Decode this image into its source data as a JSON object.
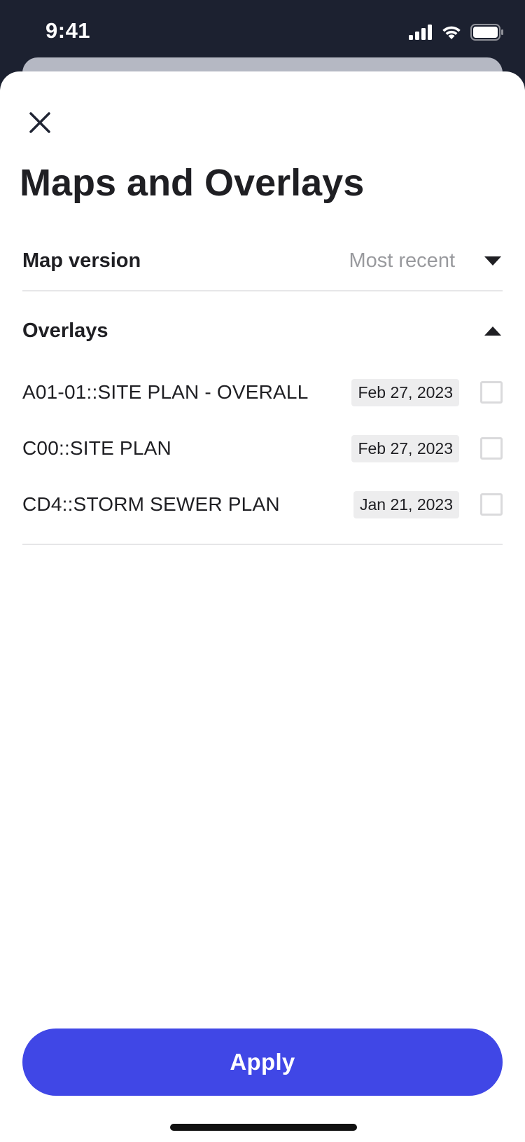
{
  "status_bar": {
    "time": "9:41",
    "icons": [
      "cellular-signal-icon",
      "wifi-icon",
      "battery-icon"
    ]
  },
  "header": {
    "close_icon": "close-icon",
    "title": "Maps and Overlays"
  },
  "map_version": {
    "label": "Map version",
    "value": "Most recent",
    "caret_icon": "caret-down-icon"
  },
  "overlays": {
    "label": "Overlays",
    "caret_icon": "caret-up-icon",
    "items": [
      {
        "name": "A01-01::SITE PLAN - OVERALL",
        "date": "Feb 27, 2023",
        "checked": false
      },
      {
        "name": "C00::SITE PLAN",
        "date": "Feb 27, 2023",
        "checked": false
      },
      {
        "name": "CD4::STORM SEWER PLAN",
        "date": "Jan 21, 2023",
        "checked": false
      }
    ]
  },
  "footer": {
    "apply_label": "Apply"
  },
  "colors": {
    "status_bar_bg": "#1c2130",
    "accent": "#4047e6",
    "muted_text": "#999a9e",
    "date_chip_bg": "#ededee",
    "divider": "#e6e6e8"
  }
}
